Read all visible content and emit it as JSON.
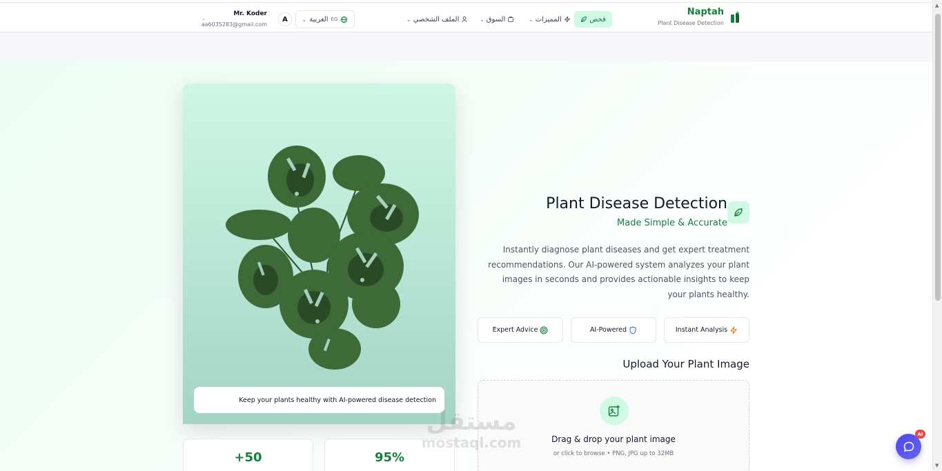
{
  "brand": {
    "title": "Naptah",
    "subtitle": "Plant Disease Detection"
  },
  "nav": {
    "active_label": "فحص",
    "features_label": "المميزات",
    "market_label": "السوق",
    "profile_label": "الملف الشخصي"
  },
  "language": {
    "label": "العربية",
    "code": "EG"
  },
  "user": {
    "name": "Mr. Koder",
    "email": "aa6035283@gmail.com",
    "avatar_letter": "A"
  },
  "hero": {
    "title": "Plant Disease Detection",
    "subtitle": "Made Simple & Accurate",
    "description": "Instantly diagnose plant diseases and get expert treatment recommendations. Our AI-powered system analyzes your plant images in seconds and provides actionable insights to keep your plants healthy.",
    "caption": "Keep your plants healthy with AI-powered disease detection"
  },
  "features": [
    {
      "label": "Expert Advice",
      "icon": "target-icon"
    },
    {
      "label": "AI-Powered",
      "icon": "shield-icon"
    },
    {
      "label": "Instant Analysis",
      "icon": "lightning-icon"
    }
  ],
  "upload": {
    "heading": "Upload Your Plant Image",
    "title": "Drag & drop your plant image",
    "hint": "or click to browse • PNG, JPG up to 32MB"
  },
  "stats": [
    {
      "value": "+50"
    },
    {
      "value": "95%"
    }
  ],
  "watermark": {
    "arabic": "مستقل",
    "latin": "mostaql.com"
  },
  "chat": {
    "badge": "AI"
  },
  "colors": {
    "accent": "#15803d",
    "accent_light": "#d1fae5",
    "chat": "#4f46e5"
  }
}
